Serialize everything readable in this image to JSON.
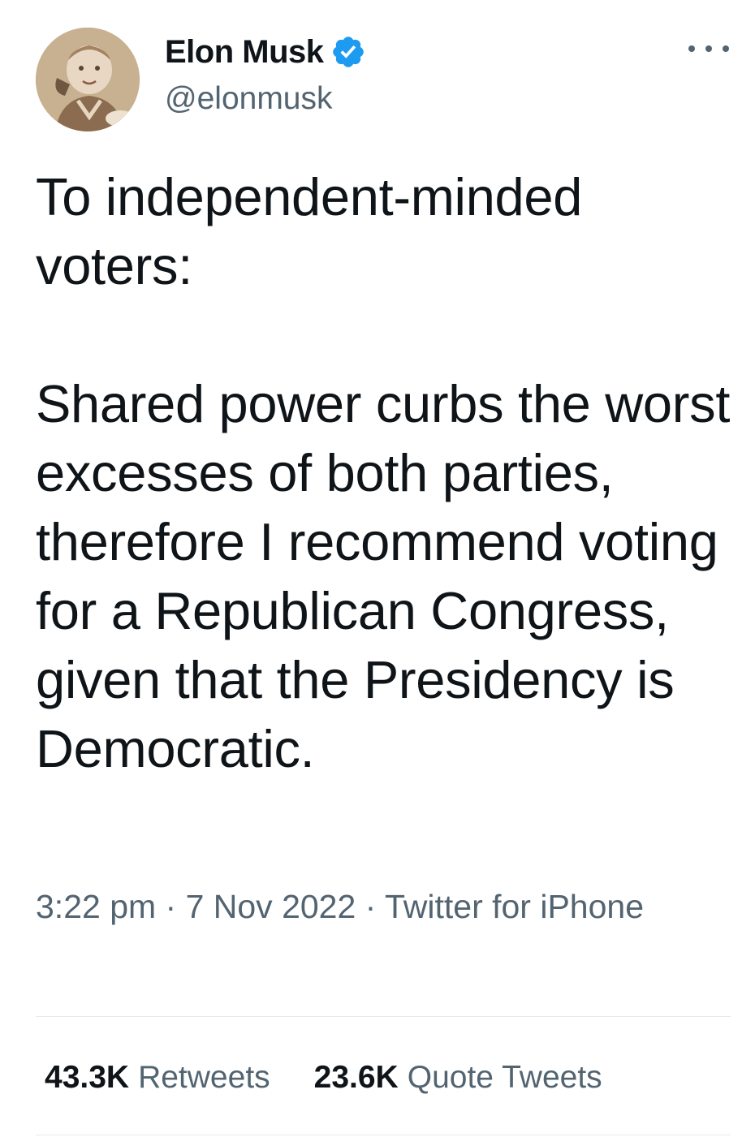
{
  "author": {
    "name": "Elon Musk",
    "handle": "@elonmusk",
    "verified": true,
    "verified_color": "#1d9bf0"
  },
  "tweet": {
    "text": "To independent-minded voters:\n\nShared power curbs the worst excesses of both parties, therefore I recommend voting for a Republican Congress, given that the Presidency is Democratic.",
    "meta": "3:22 pm · 7 Nov 2022 · Twitter for iPhone"
  },
  "stats": {
    "retweets_count": "43.3K",
    "retweets_label": "Retweets",
    "quotes_count": "23.6K",
    "quotes_label": "Quote Tweets"
  },
  "icons": {
    "more": "more-horizontal-icon",
    "verified": "verified-badge-icon"
  },
  "colors": {
    "text": "#0f1419",
    "secondary": "#536471",
    "divider": "#e6e9eb"
  }
}
